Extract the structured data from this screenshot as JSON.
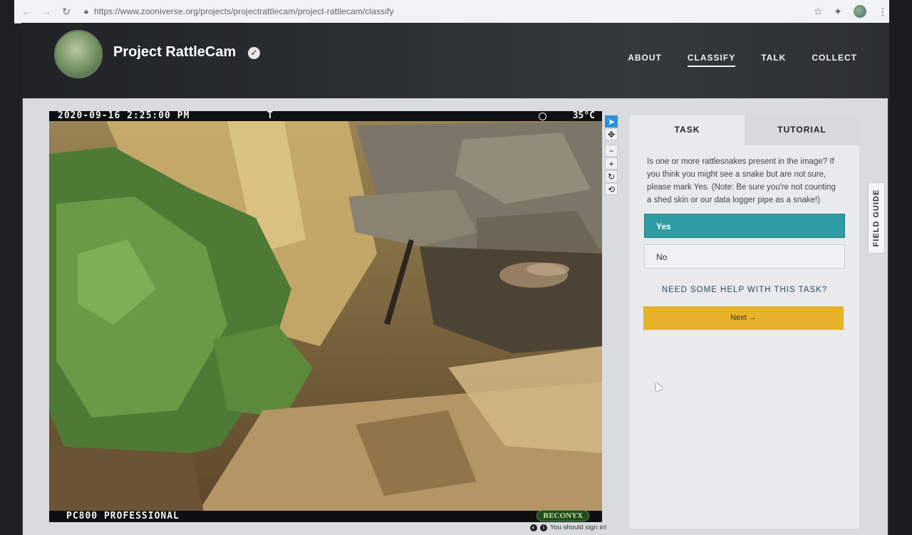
{
  "browser": {
    "url": "https://www.zooniverse.org/projects/projectrattlecam/project-rattlecam/classify"
  },
  "site": {
    "title": "Project RattleCam",
    "nav": [
      {
        "label": "ABOUT"
      },
      {
        "label": "CLASSIFY",
        "active": true
      },
      {
        "label": "TALK"
      },
      {
        "label": "COLLECT"
      }
    ]
  },
  "camera": {
    "timestamp": "2020-09-16  2:25:00 PM",
    "marker": "T",
    "temperature": "35°C",
    "model": "PC800 PROFESSIONAL",
    "brand": "RECONYX"
  },
  "task": {
    "tabs": [
      "TASK",
      "TUTORIAL"
    ],
    "question": "Is one or more rattlesnakes present in the image? If you think you might see a snake but are not sure, please mark Yes. (Note: Be sure you're not counting a shed skin or our data logger pipe as a snake!)",
    "answers": [
      "Yes",
      "No"
    ],
    "help_link": "NEED SOME HELP WITH THIS TASK?",
    "next_label": "Next →"
  },
  "field_guide_label": "FIELD GUIDE",
  "signin_text": "You should sign in!",
  "colors": {
    "accent_teal": "#2f9ca3",
    "next_yellow": "#e6b22a",
    "header_dark": "#2a2f33"
  },
  "icons": [
    "back-arrow-icon",
    "forward-arrow-icon",
    "reload-icon",
    "lock-icon",
    "star-icon",
    "extensions-icon",
    "verified-icon",
    "pointer-tool-icon",
    "move-tool-icon",
    "zoom-out-icon",
    "zoom-in-icon",
    "rotate-icon",
    "reset-icon"
  ]
}
